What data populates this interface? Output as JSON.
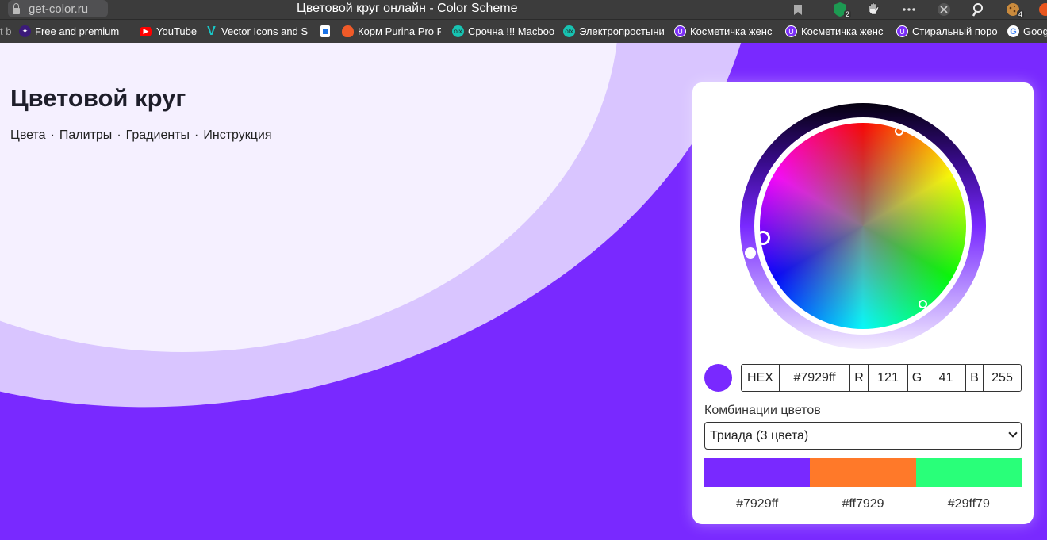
{
  "browser": {
    "url": "get-color.ru",
    "window_title": "Цветовой круг онлайн - Color Scheme",
    "toolbar_badges": {
      "shield": "2",
      "cookie": "4"
    }
  },
  "bookmarks": [
    {
      "label": "t b",
      "color": "#3c3c3c"
    },
    {
      "label": "Free and premium",
      "color": "#3b1a7a"
    },
    {
      "label": "YouTube",
      "color": "#ff0000"
    },
    {
      "label": "Vector Icons and S",
      "color": "#19c6c6"
    },
    {
      "label": "",
      "color": "#1a73e8"
    },
    {
      "label": "Корм Purina Pro P",
      "color": "#f05a28"
    },
    {
      "label": "Срочна !!! Macboo",
      "color": "#17c3b2"
    },
    {
      "label": "Электропростыни",
      "color": "#17c3b2"
    },
    {
      "label": "Косметичка женс",
      "color": "#7b2ff7"
    },
    {
      "label": "Косметичка женс",
      "color": "#7b2ff7"
    },
    {
      "label": "Стиральный поро",
      "color": "#7b2ff7"
    },
    {
      "label": "Google",
      "color": "#ffffff"
    }
  ],
  "page": {
    "title": "Цветовой круг",
    "nav": [
      "Цвета",
      "Палитры",
      "Градиенты",
      "Инструкция"
    ],
    "nav_separator": "·"
  },
  "picker": {
    "selected_color": "#7929ff",
    "hex_label": "HEX",
    "hex_value": "#7929ff",
    "r_label": "R",
    "r_value": "121",
    "g_label": "G",
    "g_value": "41",
    "b_label": "B",
    "b_value": "255",
    "combo_label": "Комбинации цветов",
    "combo_selected": "Триада (3 цвета)",
    "combo_colors": [
      "#7929ff",
      "#ff7929",
      "#29ff79"
    ]
  }
}
